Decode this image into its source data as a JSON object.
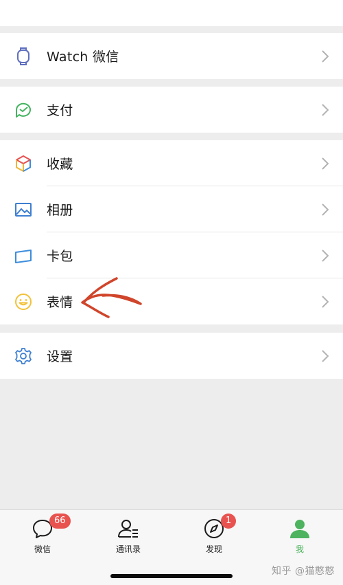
{
  "menu": {
    "watch": {
      "label": "Watch 微信",
      "icon": "watch-icon"
    },
    "pay": {
      "label": "支付",
      "icon": "wallet-icon"
    },
    "favorites": {
      "label": "收藏",
      "icon": "cube-icon"
    },
    "album": {
      "label": "相册",
      "icon": "image-icon"
    },
    "cards": {
      "label": "卡包",
      "icon": "card-icon"
    },
    "stickers": {
      "label": "表情",
      "icon": "smile-icon"
    },
    "settings": {
      "label": "设置",
      "icon": "gear-icon"
    }
  },
  "tabbar": {
    "tabs": [
      {
        "label": "微信",
        "icon": "chat-bubble-icon",
        "badge": "66",
        "active": false
      },
      {
        "label": "通讯录",
        "icon": "contacts-icon",
        "badge": "",
        "active": false
      },
      {
        "label": "发现",
        "icon": "compass-icon",
        "badge": "1",
        "active": false
      },
      {
        "label": "我",
        "icon": "person-icon",
        "badge": "",
        "active": true
      }
    ]
  },
  "watermark": "知乎 @猫憨憨",
  "colors": {
    "accent_green": "#4db35e",
    "badge_red": "#e8524f",
    "annotation_red": "#d0452b",
    "background": "#ededed"
  }
}
